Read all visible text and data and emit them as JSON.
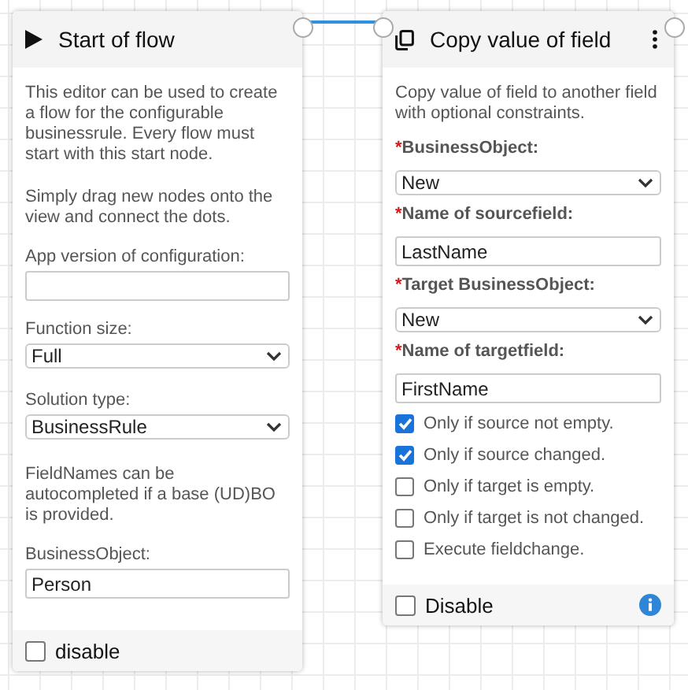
{
  "nodes": [
    {
      "kind": "start",
      "title": "Start of flow",
      "menu": false,
      "elements": [
        {
          "kind": "text",
          "text": "This editor can be used to create a flow for the configurable businessrule. Every flow must start with this start node."
        },
        {
          "kind": "text",
          "text": "Simply drag new nodes onto the view and connect the dots."
        },
        {
          "kind": "label",
          "text": "App version of configuration:"
        },
        {
          "kind": "input"
        },
        {
          "kind": "label",
          "text": "Function size:"
        },
        {
          "kind": "select",
          "value": "Full"
        },
        {
          "kind": "label",
          "text": "Solution type:"
        },
        {
          "kind": "select",
          "value": "BusinessRule"
        },
        {
          "kind": "text",
          "text": "FieldNames can be autocompleted if a base (UD)BO is provided."
        },
        {
          "kind": "label",
          "text": "BusinessObject:"
        },
        {
          "kind": "input",
          "value": "Person"
        }
      ],
      "footer": {
        "label": "disable",
        "checked": false,
        "info": false
      }
    },
    {
      "kind": "copy",
      "title": "Copy value of field",
      "menu": true,
      "elements": [
        {
          "kind": "text",
          "text": "Copy value of field to another field with optional constraints."
        },
        {
          "kind": "required_label",
          "marker": "*",
          "text": "BusinessObject:"
        },
        {
          "kind": "select",
          "value": "New"
        },
        {
          "kind": "required_label",
          "marker": "*",
          "text": "Name of sourcefield:"
        },
        {
          "kind": "input",
          "value": "LastName"
        },
        {
          "kind": "required_label",
          "marker": "*",
          "text": "Target BusinessObject:"
        },
        {
          "kind": "select",
          "value": "New"
        },
        {
          "kind": "required_label",
          "marker": "*",
          "text": "Name of targetfield:"
        },
        {
          "kind": "input",
          "value": "FirstName"
        },
        {
          "kind": "checkbox",
          "label": "Only if source not empty.",
          "checked": true
        },
        {
          "kind": "checkbox",
          "label": "Only if source changed.",
          "checked": true
        },
        {
          "kind": "checkbox",
          "label": "Only if target is empty.",
          "checked": false
        },
        {
          "kind": "checkbox",
          "label": "Only if target is not changed.",
          "checked": false
        },
        {
          "kind": "checkbox",
          "label": "Execute fieldchange.",
          "checked": false
        }
      ],
      "footer": {
        "label": "Disable",
        "checked": false,
        "info": true
      }
    }
  ]
}
